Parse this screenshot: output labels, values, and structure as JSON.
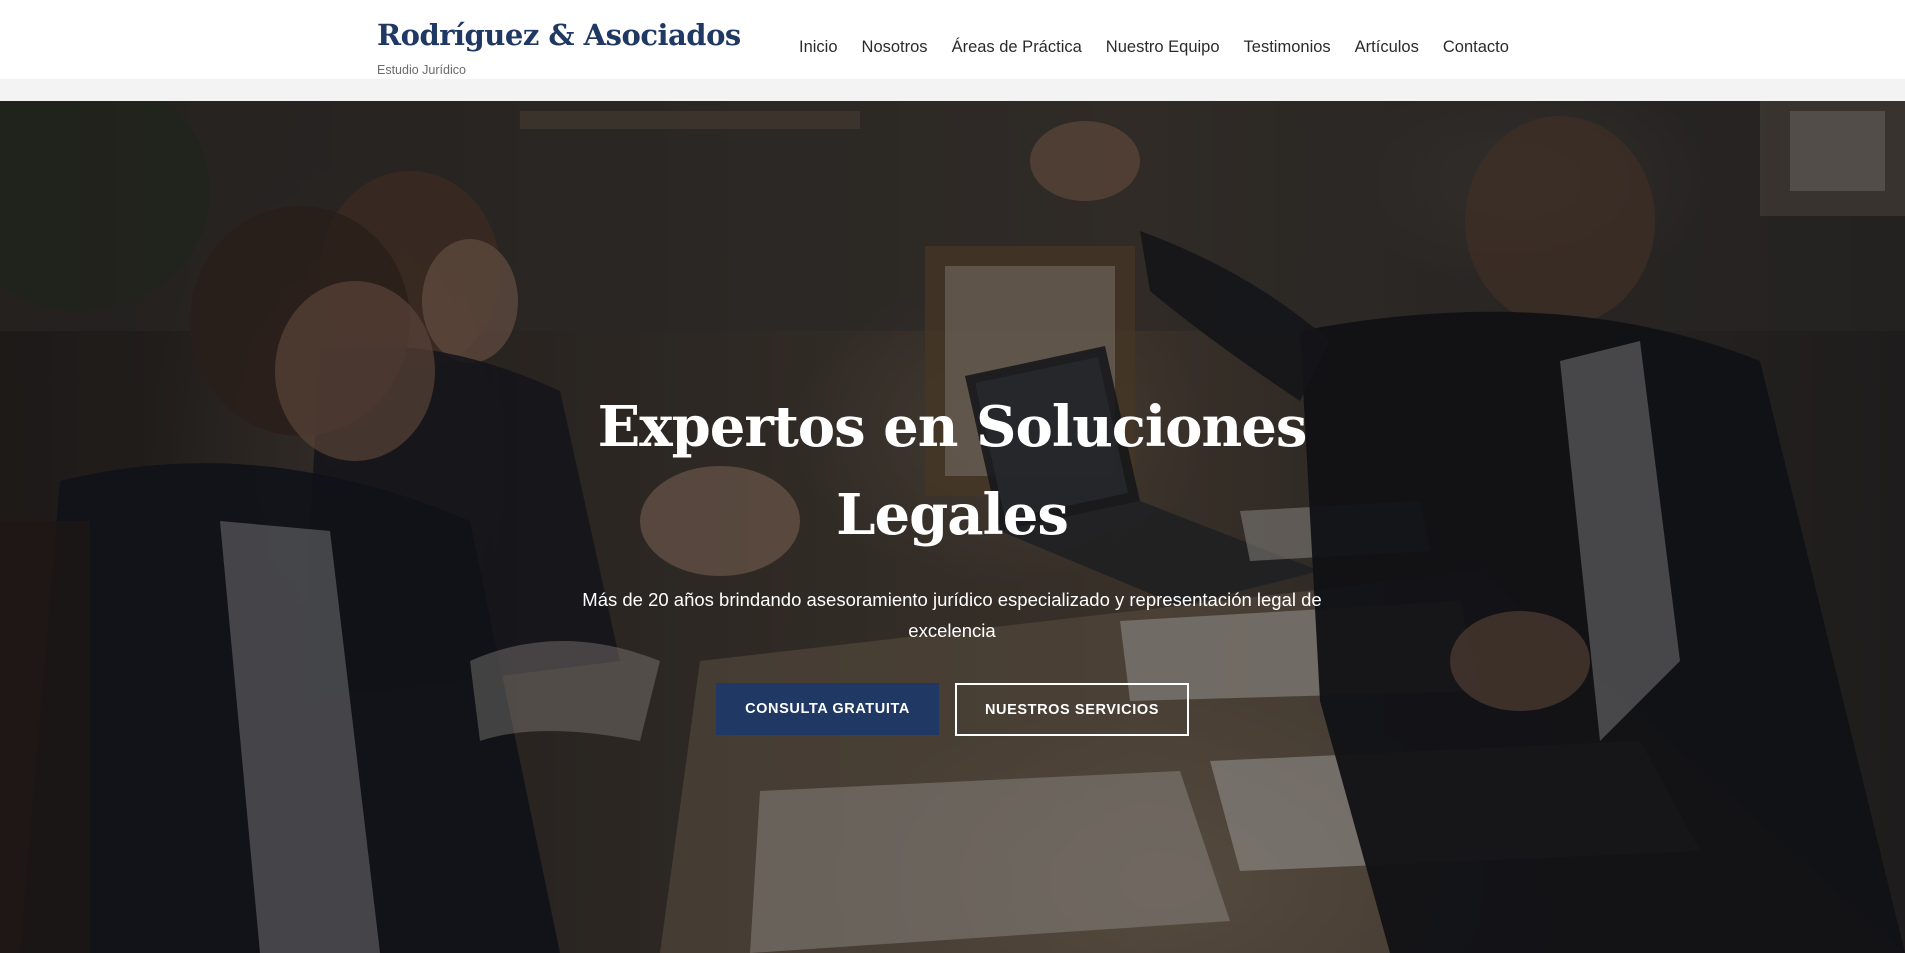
{
  "header": {
    "brand_name": "Rodríguez & Asociados",
    "brand_tagline": "Estudio Jurídico",
    "nav": [
      {
        "label": "Inicio"
      },
      {
        "label": "Nosotros"
      },
      {
        "label": "Áreas de Práctica"
      },
      {
        "label": "Nuestro Equipo"
      },
      {
        "label": "Testimonios"
      },
      {
        "label": "Artículos"
      },
      {
        "label": "Contacto"
      }
    ]
  },
  "hero": {
    "title": "Expertos en Soluciones Legales",
    "subtitle": "Más de 20 años brindando asesoramiento jurídico especializado y representación legal de excelencia",
    "primary_button": "CONSULTA GRATUITA",
    "secondary_button": "NUESTROS SERVICIOS"
  },
  "colors": {
    "brand": "#1f3864",
    "nav_text": "#2b2b2b",
    "tagline": "#6b6b6b",
    "hero_text": "#ffffff"
  }
}
